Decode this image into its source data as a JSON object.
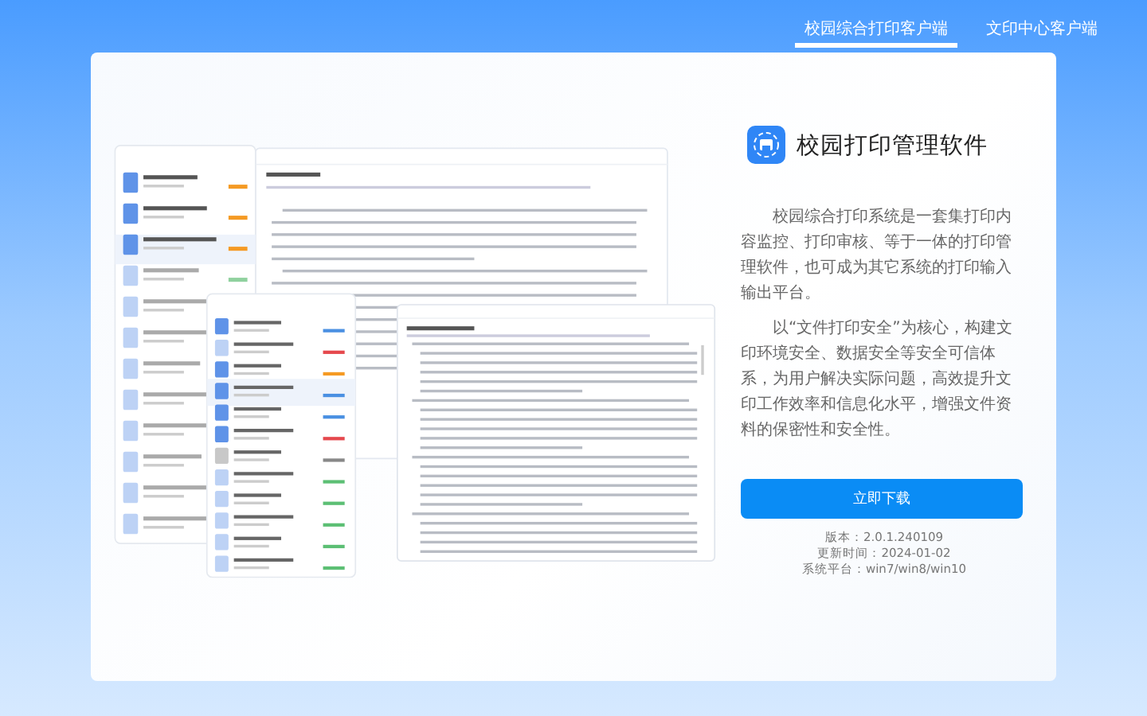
{
  "tabs": [
    {
      "label": "校园综合打印客户端",
      "selected": true
    },
    {
      "label": "文印中心客户端",
      "selected": false
    }
  ],
  "product": {
    "title": "校园打印管理软件",
    "paragraphs": [
      "校园综合打印系统是一套集打印内容监控、打印审核、等于一体的打印管理软件，也可成为其它系统的打印输入输出平台。",
      "以“文件打印安全”为核心，构建文印环境安全、数据安全等安全可信体系，为用户解决实际问题，高效提升文印工作效率和信息化水平，增强文件资料的保密性和安全性。"
    ],
    "download_button": "立即下载",
    "info": [
      "版本：2.0.1.240109",
      "更新时间：2024-01-02",
      "系统平台：win7/win8/win10"
    ]
  }
}
